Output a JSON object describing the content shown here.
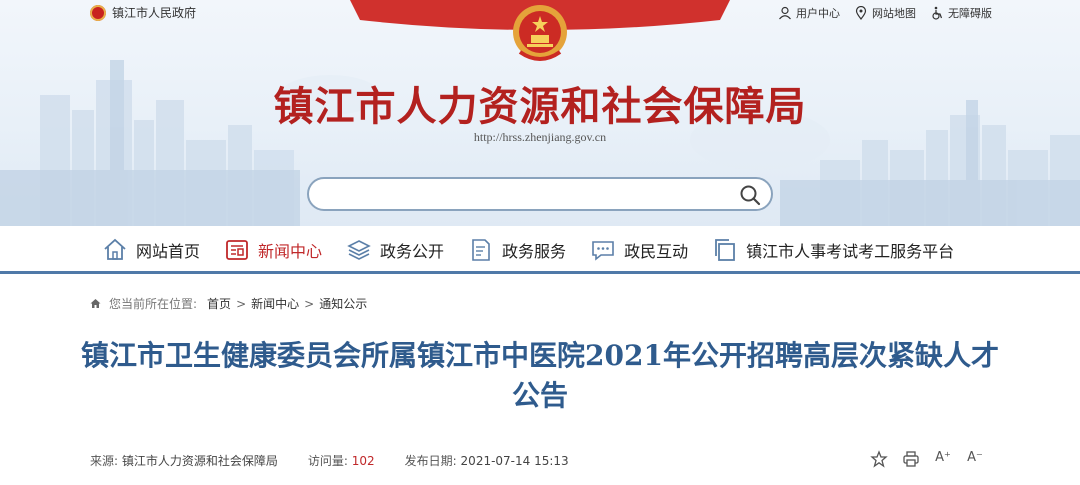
{
  "topbar": {
    "gov_link": "镇江市人民政府",
    "user_center": "用户中心",
    "site_map": "网站地图",
    "accessibility": "无障碍版"
  },
  "site": {
    "title": "镇江市人力资源和社会保障局",
    "url": "http://hrss.zhenjiang.gov.cn"
  },
  "search": {
    "placeholder": ""
  },
  "nav": {
    "items": [
      {
        "label": "网站首页",
        "icon": "home-icon"
      },
      {
        "label": "新闻中心",
        "icon": "news-icon",
        "active": true
      },
      {
        "label": "政务公开",
        "icon": "layers-icon"
      },
      {
        "label": "政务服务",
        "icon": "document-edit-icon"
      },
      {
        "label": "政民互动",
        "icon": "chat-icon"
      },
      {
        "label": "镇江市人事考试考工服务平台",
        "icon": "copy-icon"
      }
    ]
  },
  "breadcrumb": {
    "prefix": "您当前所在位置:",
    "items": [
      "首页",
      "新闻中心",
      "通知公示"
    ],
    "separator": ">"
  },
  "article": {
    "title": "镇江市卫生健康委员会所属镇江市中医院2021年公开招聘高层次紧缺人才公告",
    "source_label": "来源:",
    "source": "镇江市人力资源和社会保障局",
    "views_label": "访问量:",
    "views": "102",
    "date_label": "发布日期:",
    "date": "2021-07-14 15:13"
  },
  "tools": {
    "font_up": "A⁺",
    "font_down": "A⁻"
  },
  "colors": {
    "brand_red": "#b3211f",
    "nav_active": "#c0282a",
    "title_blue": "#2f5b8d",
    "nav_border": "#4f79a8"
  }
}
